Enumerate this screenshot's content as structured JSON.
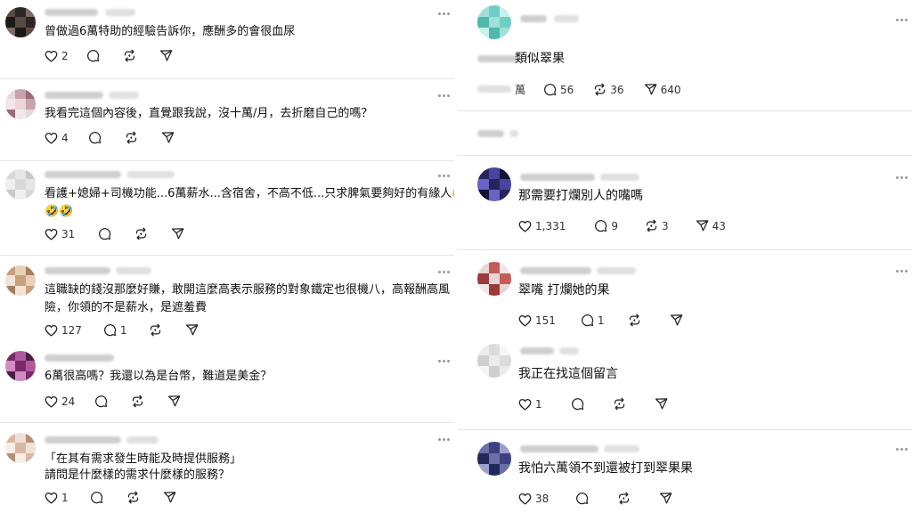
{
  "left_comments": [
    {
      "text": "曾做過6萬特助的經驗告訴你，應酬多的會很血尿",
      "likes": "2",
      "replies": "",
      "reposts": ""
    },
    {
      "text": "我看完這個內容後，直覺跟我說，沒十萬/月，去折磨自己的嗎？",
      "likes": "4",
      "replies": "",
      "reposts": ""
    },
    {
      "text_line1": "看護+媳婦+司機功能...6萬薪水...含宿舍，不高不低...只求脾氣要夠好的有緣人🤣",
      "text_line2": "🤣🤣",
      "likes": "31",
      "replies": "",
      "reposts": ""
    },
    {
      "text_line1": "這職缺的錢沒那麼好賺，敢開這麼高表示服務的對象鐵定也很機八，高報酬高風",
      "text_line2": "險，你領的不是薪水，是遮羞費",
      "likes": "127",
      "replies": "1",
      "reposts": ""
    },
    {
      "text": "6萬很高嗎？我還以為是台幣，難道是美金？",
      "likes": "24",
      "replies": "",
      "reposts": ""
    },
    {
      "text_line1": "「在其有需求發生時能及時提供服務」",
      "text_line2": "請問是什麼樣的需求什麼樣的服務？",
      "likes": "1",
      "replies": "",
      "reposts": ""
    }
  ],
  "right_comments": [
    {
      "text": "類似翠果",
      "likes": "萬",
      "replies": "56",
      "reposts": "36",
      "shares": "640"
    },
    {
      "text": "那需要打爛別人的嘴嗎",
      "likes": "1,331",
      "replies": "9",
      "reposts": "3",
      "shares": "43"
    },
    {
      "text": "翠嘴 打爛她的果",
      "likes": "151",
      "replies": "1",
      "reposts": "",
      "shares": ""
    },
    {
      "text": "我正在找這個留言",
      "likes": "1",
      "replies": "",
      "reposts": "",
      "shares": ""
    },
    {
      "text": "我怕六萬領不到還被打到翠果果",
      "likes": "38",
      "replies": "",
      "reposts": "",
      "shares": ""
    }
  ]
}
